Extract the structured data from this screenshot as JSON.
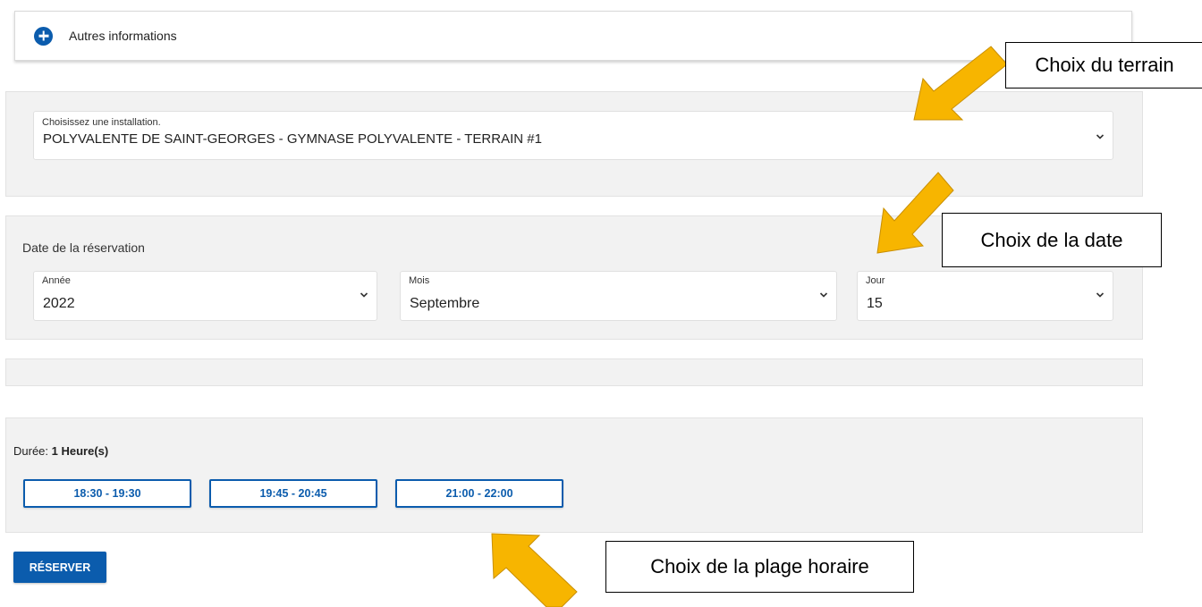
{
  "accordion": {
    "title": "Autres informations",
    "icon": "plus-circle-icon",
    "accent_color": "#0b5cad"
  },
  "installation": {
    "label": "Choisissez une installation.",
    "value": "POLYVALENTE DE SAINT-GEORGES - GYMNASE POLYVALENTE - TERRAIN #1"
  },
  "date": {
    "title": "Date de la réservation",
    "annee": {
      "label": "Année",
      "value": "2022"
    },
    "mois": {
      "label": "Mois",
      "value": "Septembre"
    },
    "jour": {
      "label": "Jour",
      "value": "15"
    }
  },
  "duration": {
    "label": "Durée:",
    "value": "1 Heure(s)"
  },
  "time_slots": [
    {
      "label": "18:30 - 19:30"
    },
    {
      "label": "19:45 - 20:45"
    },
    {
      "label": "21:00 - 22:00"
    }
  ],
  "actions": {
    "reserve_label": "RÉSERVER"
  },
  "annotations": {
    "terrain": "Choix du terrain",
    "date": "Choix de la date",
    "plage": "Choix de la plage horaire",
    "arrow_color": "#f7b500"
  }
}
